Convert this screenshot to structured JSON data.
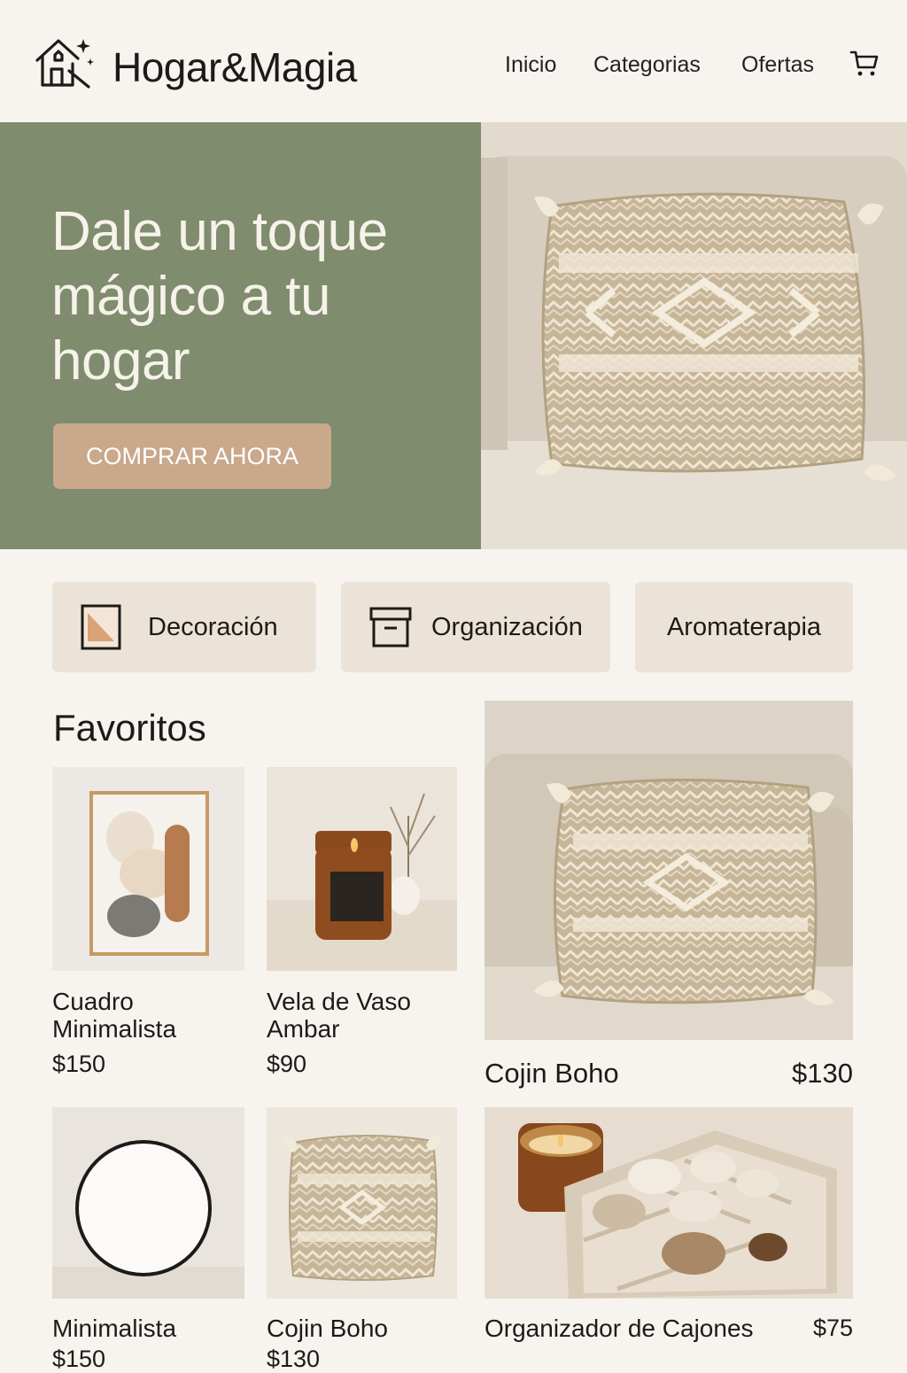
{
  "header": {
    "brand": "Hogar&Magia",
    "nav": [
      "Inicio",
      "Categorias",
      "Ofertas"
    ],
    "cart_icon": "shopping-cart-icon",
    "logo_icon": "magic-house-icon"
  },
  "hero": {
    "title": "Dale un toque mágico a tu hogar",
    "cta": "COMPRAR AHORA",
    "image_icon": "boho-pillow-image"
  },
  "categories": [
    {
      "label": "Decoración",
      "icon": "frame-icon"
    },
    {
      "label": "Organización",
      "icon": "box-icon"
    },
    {
      "label": "Aromaterapia",
      "icon": ""
    }
  ],
  "favorites": {
    "title": "Favoritos",
    "products": [
      {
        "name": "Cuadro Minimalista",
        "price": "$150"
      },
      {
        "name": "Vela de Vaso Ambar",
        "price": "$90"
      },
      {
        "name": "Cojin Boho",
        "price": "$130"
      },
      {
        "name": "Minimalista",
        "price": "$150"
      },
      {
        "name": "Cojin Boho",
        "price": "$130"
      },
      {
        "name": "Organizador de Cajones",
        "price": "$75"
      }
    ]
  },
  "colors": {
    "background": "#f7f4ef",
    "hero_green": "#7f8c6e",
    "cta": "#c9a88b",
    "chip": "#ebe3d8"
  }
}
